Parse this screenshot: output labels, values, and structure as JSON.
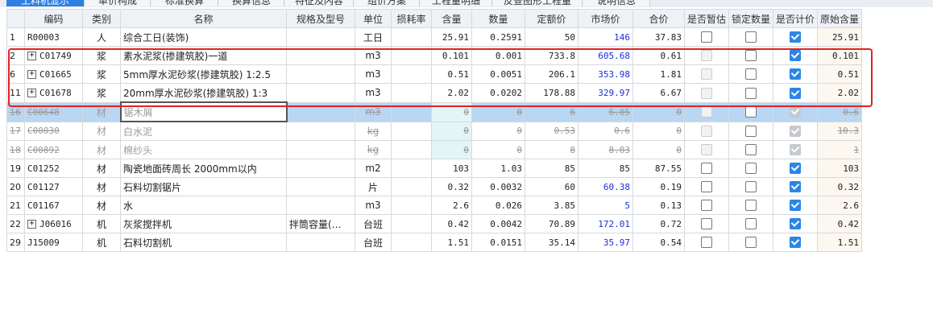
{
  "tabs": [
    {
      "label": "工料机显示"
    },
    {
      "label": "单价构成"
    },
    {
      "label": "标准换算"
    },
    {
      "label": "换算信息"
    },
    {
      "label": "特征及内容"
    },
    {
      "label": "组价方案"
    },
    {
      "label": "工程量明细"
    },
    {
      "label": "反查图形工程量"
    },
    {
      "label": "说明信息"
    }
  ],
  "columns": [
    "编码",
    "类别",
    "名称",
    "规格及型号",
    "单位",
    "损耗率",
    "含量",
    "数量",
    "定额价",
    "市场价",
    "合价",
    "是否暂估",
    "锁定数量",
    "是否计价",
    "原始含量"
  ],
  "rows": [
    {
      "idx": "1",
      "code": "R00003",
      "type": "人",
      "name": "综合工日(装饰)",
      "spec": "",
      "unit": "工日",
      "loss": "",
      "qty": "25.91",
      "amount": "0.2591",
      "fixed": "50",
      "market": "146",
      "total": "37.83",
      "est": "none",
      "lock": false,
      "priced": true,
      "orig": "25.91"
    },
    {
      "idx": "2",
      "code": "C01749",
      "expand": true,
      "type": "浆",
      "name": "素水泥浆(掺建筑胶)一道",
      "spec": "",
      "unit": "m3",
      "loss": "",
      "qty": "0.101",
      "amount": "0.001",
      "fixed": "733.8",
      "market": "605.68",
      "total": "0.61",
      "est": "disabled",
      "lock": false,
      "priced": true,
      "orig": "0.101"
    },
    {
      "idx": "6",
      "code": "C01665",
      "expand": true,
      "type": "浆",
      "name": "5mm厚水泥砂浆(掺建筑胶) 1:2.5",
      "spec": "",
      "unit": "m3",
      "loss": "",
      "qty": "0.51",
      "amount": "0.0051",
      "fixed": "206.1",
      "market": "353.98",
      "total": "1.81",
      "est": "disabled",
      "lock": false,
      "priced": true,
      "orig": "0.51"
    },
    {
      "idx": "11",
      "code": "C01678",
      "expand": true,
      "type": "浆",
      "name": "20mm厚水泥砂浆(掺建筑胶) 1:3",
      "spec": "",
      "unit": "m3",
      "loss": "",
      "qty": "2.02",
      "amount": "0.0202",
      "fixed": "178.88",
      "market": "329.97",
      "total": "6.67",
      "est": "disabled",
      "lock": false,
      "priced": true,
      "orig": "2.02"
    },
    {
      "idx": "16",
      "code": "C00648",
      "type": "材",
      "name": "锯木屑",
      "spec": "",
      "unit": "m3",
      "loss": "",
      "qty": "0",
      "amount": "0",
      "fixed": "6",
      "market": "6.05",
      "total": "0",
      "est": "disabled",
      "lock": false,
      "priced": "disabled",
      "orig": "0.6",
      "deleted": true,
      "selected": true
    },
    {
      "idx": "17",
      "code": "C00030",
      "type": "材",
      "name": "白水泥",
      "spec": "",
      "unit": "kg",
      "loss": "",
      "qty": "0",
      "amount": "0",
      "fixed": "0.53",
      "market": "0.6",
      "total": "0",
      "est": "disabled",
      "lock": false,
      "priced": "disabled",
      "orig": "10.3",
      "deleted": true
    },
    {
      "idx": "18",
      "code": "C00892",
      "type": "材",
      "name": "棉纱头",
      "spec": "",
      "unit": "kg",
      "loss": "",
      "qty": "0",
      "amount": "0",
      "fixed": "8",
      "market": "8.03",
      "total": "0",
      "est": "disabled",
      "lock": false,
      "priced": "disabled",
      "orig": "1",
      "deleted": true
    },
    {
      "idx": "19",
      "code": "C01252",
      "type": "材",
      "name": "陶瓷地面砖周长 2000mm以内",
      "spec": "",
      "unit": "m2",
      "loss": "",
      "qty": "103",
      "amount": "1.03",
      "fixed": "85",
      "market": "85",
      "total": "87.55",
      "est": "none",
      "lock": false,
      "priced": true,
      "orig": "103",
      "market_plain": true
    },
    {
      "idx": "20",
      "code": "C01127",
      "type": "材",
      "name": "石料切割锯片",
      "spec": "",
      "unit": "片",
      "loss": "",
      "qty": "0.32",
      "amount": "0.0032",
      "fixed": "60",
      "market": "60.38",
      "total": "0.19",
      "est": "none",
      "lock": false,
      "priced": true,
      "orig": "0.32"
    },
    {
      "idx": "21",
      "code": "C01167",
      "type": "材",
      "name": "水",
      "spec": "",
      "unit": "m3",
      "loss": "",
      "qty": "2.6",
      "amount": "0.026",
      "fixed": "3.85",
      "market": "5",
      "total": "0.13",
      "est": "none",
      "lock": false,
      "priced": true,
      "orig": "2.6"
    },
    {
      "idx": "22",
      "code": "J06016",
      "expand": true,
      "type": "机",
      "name": "灰浆搅拌机",
      "spec": "拌筒容量(…",
      "unit": "台班",
      "loss": "",
      "qty": "0.42",
      "amount": "0.0042",
      "fixed": "70.89",
      "market": "172.01",
      "total": "0.72",
      "est": "none",
      "lock": false,
      "priced": true,
      "orig": "0.42"
    },
    {
      "idx": "29",
      "code": "J15009",
      "type": "机",
      "name": "石料切割机",
      "spec": "",
      "unit": "台班",
      "loss": "",
      "qty": "1.51",
      "amount": "0.0151",
      "fixed": "35.14",
      "market": "35.97",
      "total": "0.54",
      "est": "none",
      "lock": false,
      "priced": true,
      "orig": "1.51"
    }
  ],
  "colors": {
    "accent": "#2f7fe0",
    "price": "#1a2fd8",
    "highlight": "#e32222",
    "selected_row": "#b9d6f3"
  }
}
